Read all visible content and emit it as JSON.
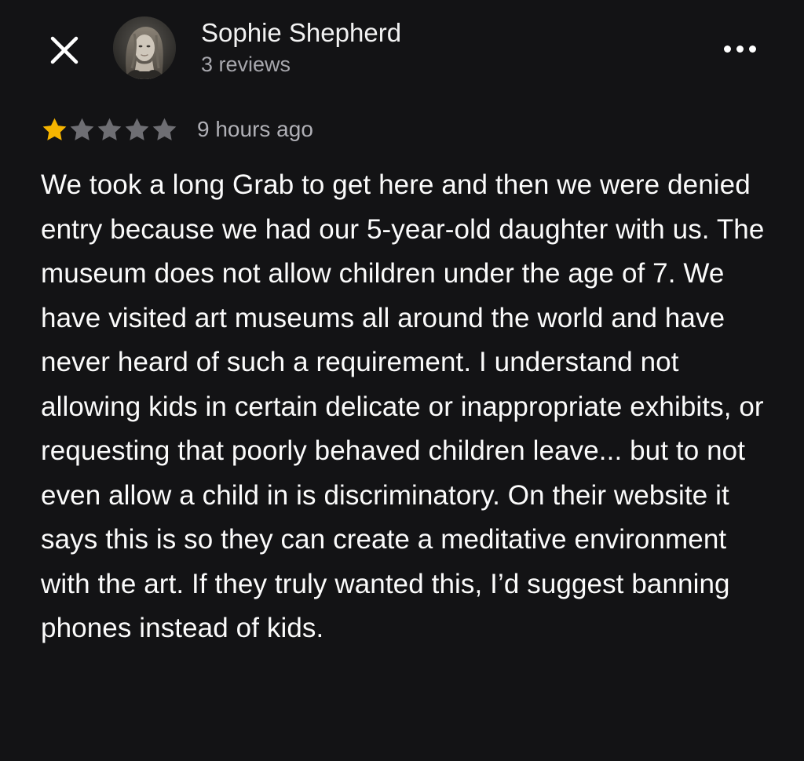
{
  "header": {
    "close_icon": "close-icon",
    "more_icon": "more-horizontal-icon",
    "author": {
      "name": "Sophie Shepherd",
      "reviews_count": "3 reviews",
      "avatar": "avatar-photo"
    }
  },
  "review": {
    "rating": 1,
    "max_rating": 5,
    "star_filled_color": "#f5b400",
    "star_empty_color": "#6e6e73",
    "time_ago": "9 hours ago",
    "text": "We took a long Grab to get here and then we were denied entry because we had our 5-year-old daughter with us. The museum does not allow children under the age of 7. We have visited art museums all around the world and have never heard of such a requirement. I understand not allowing kids in certain delicate or inappropriate exhibits, or requesting that poorly behaved children leave... but to not even allow a child in is discriminatory. On their website it says this is so they can create a meditative environment with the art. If they truly wanted this, I’d suggest banning phones instead of kids."
  },
  "colors": {
    "background": "#131315",
    "primary_text": "#ffffff",
    "secondary_text": "#a7a7ad"
  }
}
